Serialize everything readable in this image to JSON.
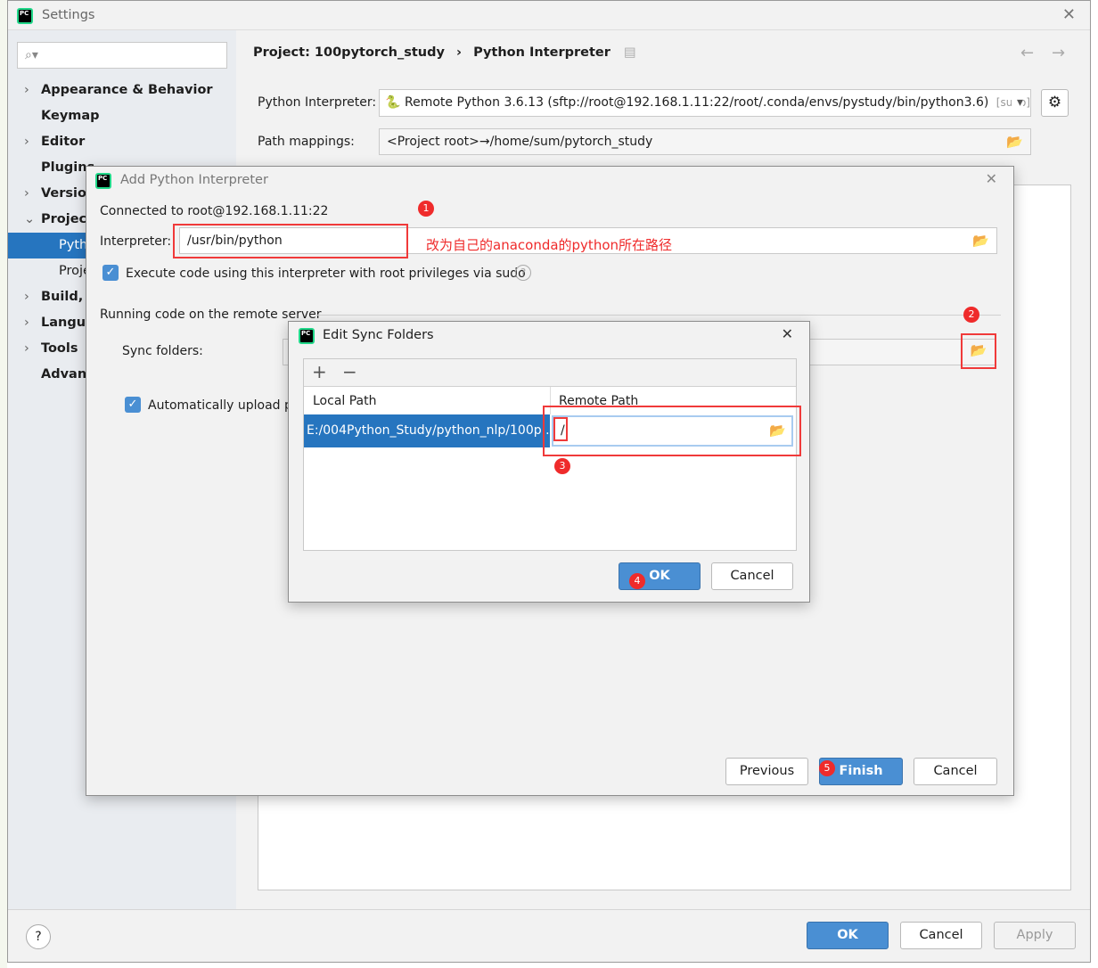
{
  "settings": {
    "title": "Settings",
    "search_placeholder": "",
    "nav": [
      {
        "label": "Appearance & Behavior",
        "expandable": true
      },
      {
        "label": "Keymap"
      },
      {
        "label": "Editor",
        "expandable": true
      },
      {
        "label": "Plugins"
      },
      {
        "label": "Version",
        "expandable": true
      },
      {
        "label": "Project:",
        "expanded": true
      },
      {
        "label": "Pyth",
        "selected": true,
        "child": true
      },
      {
        "label": "Proje",
        "child": true
      },
      {
        "label": "Build, E",
        "expandable": true
      },
      {
        "label": "Langua",
        "expandable": true
      },
      {
        "label": "Tools",
        "expandable": true
      },
      {
        "label": "Advanc"
      }
    ],
    "breadcrumb": {
      "project": "Project: 100pytorch_study",
      "separator": "›",
      "page": "Python Interpreter"
    },
    "interpreter_label": "Python Interpreter:",
    "interpreter_value": "Remote Python 3.6.13 (sftp://root@192.168.1.11:22/root/.conda/envs/pystudy/bin/python3.6)",
    "interpreter_tag": "[sudo]",
    "path_mappings_label": "Path mappings:",
    "path_mappings_value": "<Project root>→/home/sum/pytorch_study",
    "ok": "OK",
    "cancel": "Cancel",
    "apply": "Apply",
    "help": "?"
  },
  "add_interpreter": {
    "title": "Add Python Interpreter",
    "connected": "Connected to root@192.168.1.11:22",
    "interpreter_label": "Interpreter:",
    "interpreter_value": "/usr/bin/python",
    "annotation": "改为自己的anaconda的python所在路径",
    "sudo_label": "Execute code using this interpreter with root privileges via sudo",
    "sudo_checked": true,
    "section": "Running code on the remote server",
    "sync_label": "Sync folders:",
    "auto_upload_label": "Automatically upload p",
    "auto_upload_checked": true,
    "previous": "Previous",
    "finish": "Finish",
    "cancel": "Cancel"
  },
  "sync_dialog": {
    "title": "Edit Sync Folders",
    "add": "+",
    "remove": "−",
    "columns": [
      "Local Path",
      "Remote Path"
    ],
    "rows": [
      {
        "local": "E:/004Python_Study/python_nlp/100p...",
        "remote": "/"
      }
    ],
    "ok": "OK",
    "cancel": "Cancel"
  },
  "badges": [
    "1",
    "2",
    "3",
    "4",
    "5"
  ],
  "colors": {
    "accent": "#4a8fd3",
    "selection": "#2675bf",
    "annotation": "#ef2b2b"
  }
}
